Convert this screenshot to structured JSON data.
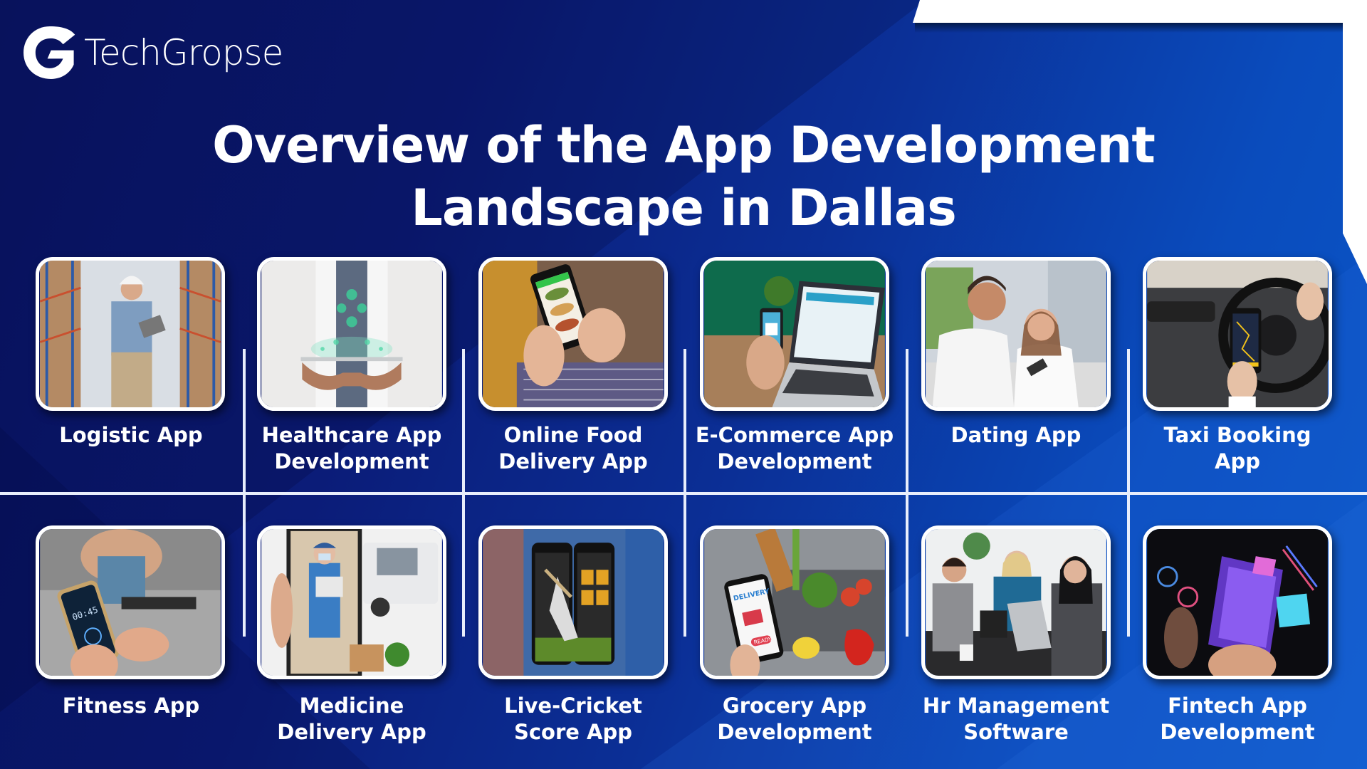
{
  "brand": {
    "name": "TechGropse",
    "logo_icon": "g-logo-icon"
  },
  "title": {
    "line1": "Overview of the App Development",
    "line2": "Landscape in Dallas"
  },
  "colors": {
    "background_dark": "#0a1668",
    "background_light": "#0a56c8",
    "text": "#ffffff",
    "divider": "#e8eefc"
  },
  "top_row": [
    {
      "label_line1": "Logistic App",
      "label_line2": "",
      "image": "warehouse-worker-with-tablet"
    },
    {
      "label_line1": "Healthcare App",
      "label_line2": "Development",
      "image": "doctor-holding-tablet-with-health-icons"
    },
    {
      "label_line1": "Online Food",
      "label_line2": "Delivery App",
      "image": "hands-holding-phone-food-delivery"
    },
    {
      "label_line1": "E-Commerce App",
      "label_line2": "Development",
      "image": "laptop-online-shop-and-phone-qr"
    },
    {
      "label_line1": "Dating App",
      "label_line2": "",
      "image": "couple-looking-at-phone"
    },
    {
      "label_line1": "Taxi Booking",
      "label_line2": "App",
      "image": "driver-phone-navigation-steering-wheel"
    }
  ],
  "bottom_row": [
    {
      "label_line1": "Fitness App",
      "label_line2": "",
      "image": "phone-stopwatch-gym",
      "screen_text": "00:45"
    },
    {
      "label_line1": "Medicine",
      "label_line2": "Delivery App",
      "image": "delivery-man-in-phone-with-van"
    },
    {
      "label_line1": "Live-Cricket",
      "label_line2": "Score App",
      "image": "cricket-app-phones"
    },
    {
      "label_line1": "Grocery App",
      "label_line2": "Development",
      "image": "grocery-basket-phone-delivery",
      "screen_text": "DELIVERY",
      "badge": "READY"
    },
    {
      "label_line1": "Hr Management",
      "label_line2": "Software",
      "image": "office-team-with-laptops"
    },
    {
      "label_line1": "Fintech App",
      "label_line2": "Development",
      "image": "holographic-fintech-phone"
    }
  ]
}
